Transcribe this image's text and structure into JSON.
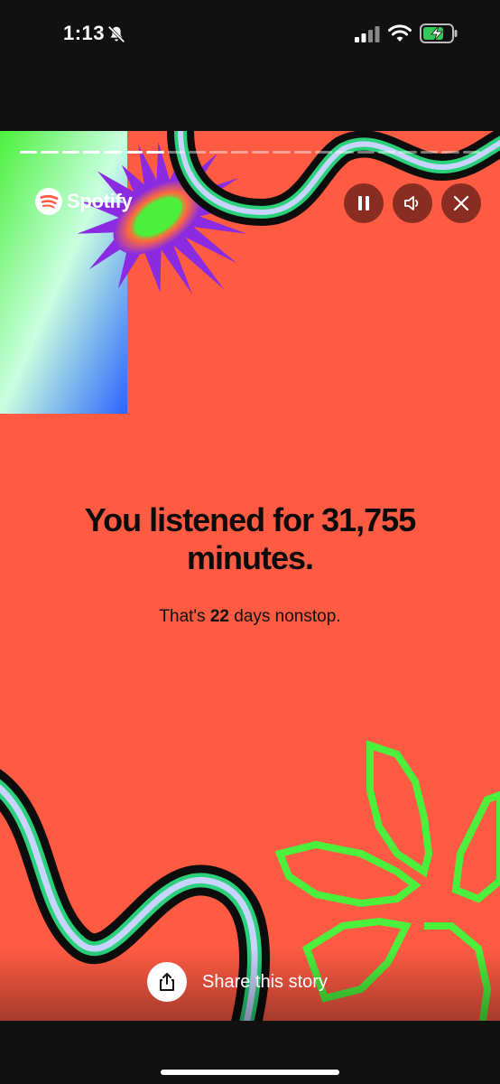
{
  "status_bar": {
    "time": "1:13",
    "icons": [
      "bell-slash-icon",
      "signal-icon",
      "wifi-icon",
      "battery-charging-icon"
    ]
  },
  "story": {
    "progress": {
      "total_segments": 22,
      "completed_segments": 7
    },
    "brand": {
      "name": "Spotify",
      "icon": "spotify-logo-icon"
    },
    "controls": {
      "pause_icon": "pause-icon",
      "volume_icon": "volume-icon",
      "close_icon": "close-icon"
    },
    "headline_line1": "You listened for 31,755",
    "headline_line2": "minutes.",
    "sub_prefix": "That's ",
    "sub_days": "22",
    "sub_suffix": " days nonstop.",
    "share_label": "Share this story",
    "share_icon": "share-icon"
  },
  "colors": {
    "background": "#ff5a42",
    "accent_green": "#4cf03c",
    "accent_purple": "#8a2be2",
    "text_dark": "#0b0b0b"
  }
}
